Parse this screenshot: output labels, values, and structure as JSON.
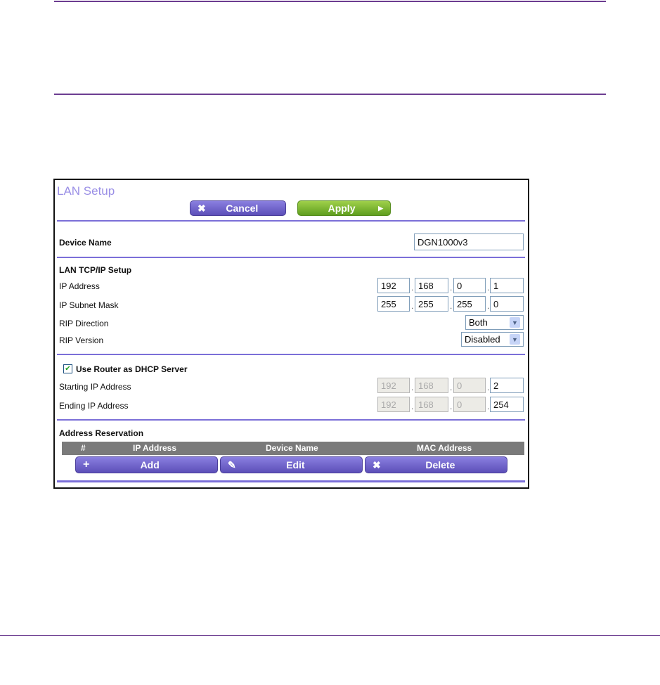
{
  "page_title": "LAN Setup",
  "buttons": {
    "cancel": "Cancel",
    "apply": "Apply",
    "add": "Add",
    "edit": "Edit",
    "delete": "Delete"
  },
  "device_name": {
    "label": "Device Name",
    "value": "DGN1000v3"
  },
  "lan_tcpip": {
    "heading": "LAN TCP/IP Setup",
    "ip_label": "IP Address",
    "ip": [
      "192",
      "168",
      "0",
      "1"
    ],
    "mask_label": "IP Subnet Mask",
    "mask": [
      "255",
      "255",
      "255",
      "0"
    ],
    "rip_direction_label": "RIP Direction",
    "rip_direction": "Both",
    "rip_version_label": "RIP Version",
    "rip_version": "Disabled"
  },
  "dhcp": {
    "checkbox_label": "Use Router as DHCP Server",
    "checked": true,
    "start_label": "Starting IP Address",
    "start": [
      "192",
      "168",
      "0",
      "2"
    ],
    "end_label": "Ending IP Address",
    "end": [
      "192",
      "168",
      "0",
      "254"
    ]
  },
  "reservation": {
    "heading": "Address Reservation",
    "columns": [
      "#",
      "IP Address",
      "Device Name",
      "MAC Address"
    ]
  }
}
